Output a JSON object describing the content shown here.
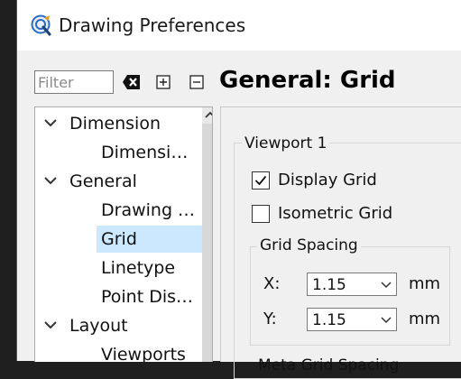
{
  "window": {
    "title": "Drawing Preferences"
  },
  "filter": {
    "placeholder": "Filter",
    "value": ""
  },
  "section_title": "General: Grid",
  "tree": {
    "items": [
      {
        "label": "Dimension",
        "level": 0,
        "expanded": true
      },
      {
        "label": "Dimensi…",
        "level": 1
      },
      {
        "label": "General",
        "level": 0,
        "expanded": true
      },
      {
        "label": "Drawing …",
        "level": 1
      },
      {
        "label": "Grid",
        "level": 1,
        "selected": true
      },
      {
        "label": "Linetype",
        "level": 1
      },
      {
        "label": "Point Dis…",
        "level": 1
      },
      {
        "label": "Layout",
        "level": 0,
        "expanded": true
      },
      {
        "label": "Viewports",
        "level": 1
      }
    ]
  },
  "viewport": {
    "title": "Viewport 1",
    "display_grid": {
      "label": "Display Grid",
      "checked": true
    },
    "isometric_grid": {
      "label": "Isometric Grid",
      "checked": false
    },
    "grid_spacing": {
      "title": "Grid Spacing",
      "x": {
        "label": "X:",
        "value": "1.15",
        "unit": "mm"
      },
      "y": {
        "label": "Y:",
        "value": "1.15",
        "unit": "mm"
      }
    },
    "meta_grid_title_partial": "Meta Grid Spacing"
  },
  "colors": {
    "selection": "#cce8ff",
    "background": "#f0f0f0",
    "icon_blue": "#2a6cc4"
  }
}
